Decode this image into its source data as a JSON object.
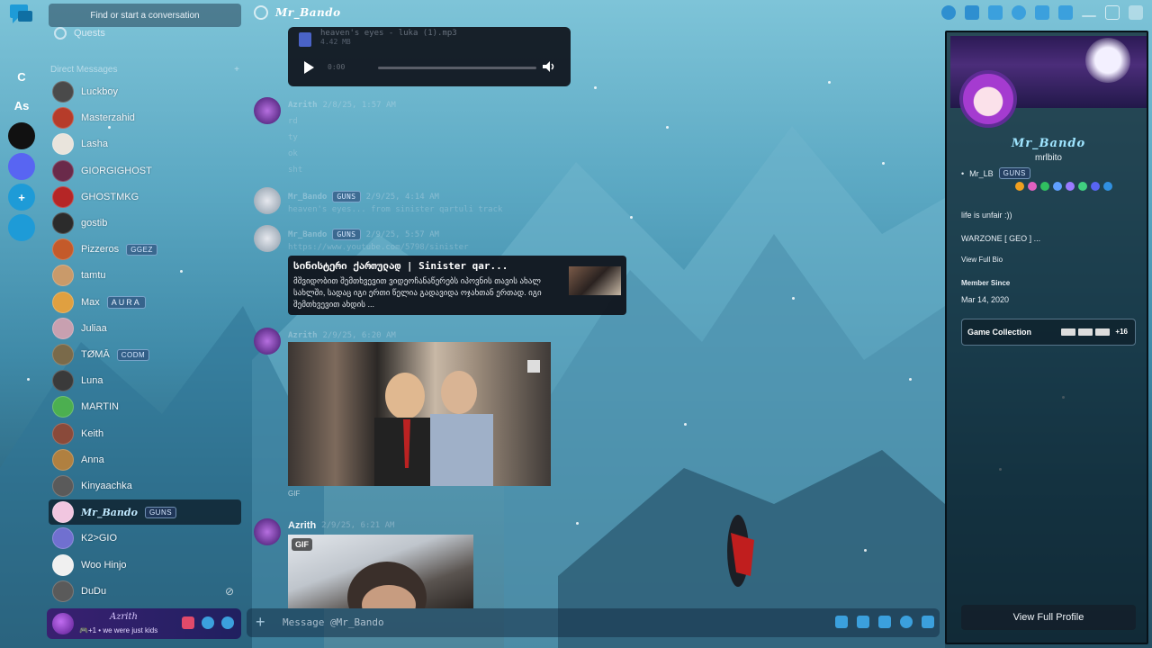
{
  "topbar": {
    "search_label": "Find or start a conversation",
    "conversation_name": "Mr_Bando"
  },
  "rail": {
    "items": [
      {
        "label": "",
        "color": "#c93f6b"
      },
      {
        "label": "C",
        "color": "transparent"
      },
      {
        "label": "As",
        "color": "transparent"
      },
      {
        "label": "",
        "color": "#111111"
      },
      {
        "label": "",
        "color": "#5865f2"
      },
      {
        "label": "+",
        "color": "#1e9bd7"
      },
      {
        "label": "",
        "color": "#1e9bd7"
      }
    ]
  },
  "dm_panel": {
    "quests_label": "Quests",
    "header_label": "Direct Messages",
    "items": [
      {
        "name": "Luckboy",
        "tag": "",
        "avatar": "#4a4a4a"
      },
      {
        "name": "Masterzahid",
        "tag": "",
        "avatar": "#b63c2a"
      },
      {
        "name": "Lasha",
        "tag": "",
        "avatar": "#e9e4dc"
      },
      {
        "name": "GIORGIGHOST",
        "tag": "",
        "avatar": "#6a2a4a"
      },
      {
        "name": "GHOSTMKG",
        "tag": "",
        "avatar": "#b52626"
      },
      {
        "name": "gostib",
        "tag": "",
        "avatar": "#2b2b2b"
      },
      {
        "name": "Pizzeros",
        "tag": "GGEZ",
        "avatar": "#c45a2a"
      },
      {
        "name": "tamtu",
        "tag": "",
        "avatar": "#c99a6a"
      },
      {
        "name": "Max",
        "tag": "AURA",
        "avatar": "#e0a040"
      },
      {
        "name": "Juliaa",
        "tag": "",
        "avatar": "#c8a0b0"
      },
      {
        "name": "TØMĀ",
        "tag": "CODM",
        "avatar": "#7a6a4a"
      },
      {
        "name": "Luna",
        "tag": "",
        "avatar": "#3a3a3a"
      },
      {
        "name": "MARTIN",
        "tag": "",
        "avatar": "#4caf50"
      },
      {
        "name": "Keith",
        "tag": "",
        "avatar": "#8a4a3a"
      },
      {
        "name": "Anna",
        "tag": "",
        "avatar": "#b08040"
      },
      {
        "name": "Kinyaachka",
        "tag": "",
        "avatar": "#5a5a5a"
      },
      {
        "name": "Mr_Bando",
        "tag": "GUNS",
        "avatar": "#f1c6e0"
      },
      {
        "name": "K2>GIO",
        "tag": "",
        "avatar": "#7070d0"
      },
      {
        "name": "Woo Hinjo",
        "tag": "",
        "avatar": "#f0f0f0"
      },
      {
        "name": "DuDu",
        "tag": "",
        "avatar": "#5a5a5a"
      }
    ],
    "close_symbol": "⊘"
  },
  "user_panel": {
    "name": "Azrith",
    "status": "🎮+1 • we were just kids"
  },
  "chat": {
    "audio": {
      "filename": "heaven's eyes - luka (1).mp3",
      "size": "4.42 MB",
      "time": "0:00"
    },
    "messages": [
      {
        "author": "Azrith",
        "timestamp": "2/8/25, 1:57 AM",
        "lines": [
          "rd",
          "ty",
          "ok",
          "sht"
        ]
      },
      {
        "author": "Mr_Bando",
        "tag": "GUNS",
        "timestamp": "2/9/25, 4:14 AM",
        "lines": [
          "heaven's eyes... from sinister qartuli track"
        ]
      },
      {
        "author": "Mr_Bando",
        "tag": "GUNS",
        "timestamp": "2/9/25, 5:57 AM",
        "lines": [
          "https://www.youtube.com/5798/sinister"
        ]
      },
      {
        "author": "Azrith",
        "timestamp": "2/9/25, 6:20 AM",
        "lines": []
      },
      {
        "author": "Azrith",
        "timestamp": "2/9/25, 6:21 AM",
        "lines": []
      }
    ],
    "embed": {
      "title": "სინისტერი ქართულად | Sinister qar...",
      "description": "მშვიდობით შემთხვევით ვიდეოჩანაწერებს იპოვნის თავის ახალ სახლში, სადაც იგი ერთი წელია გადავიდა ოჯახთან ერთად. იგი შემთხვევით ახდის ..."
    },
    "gif_label": "GIF",
    "gif_badge": "GIF",
    "composer_placeholder": "Message @Mr_Bando"
  },
  "profile": {
    "display_name": "Mr_Bando",
    "username": "mrlbito",
    "server_tag_label": "Mr_LB",
    "server_tag": "GUNS",
    "bio_line1": "life is unfair :))",
    "bio_line2": "WARZONE [ GEO ] ...",
    "view_full_bio": "View Full Bio",
    "member_since_label": "Member Since",
    "member_since": "Mar 14, 2020",
    "game_collection_label": "Game Collection",
    "game_more": "+16",
    "view_full_profile": "View Full Profile"
  },
  "colors": {
    "accent": "#5865f2",
    "name_fancy": "#9fe5ff",
    "panel_dark": "#0c0e16"
  }
}
